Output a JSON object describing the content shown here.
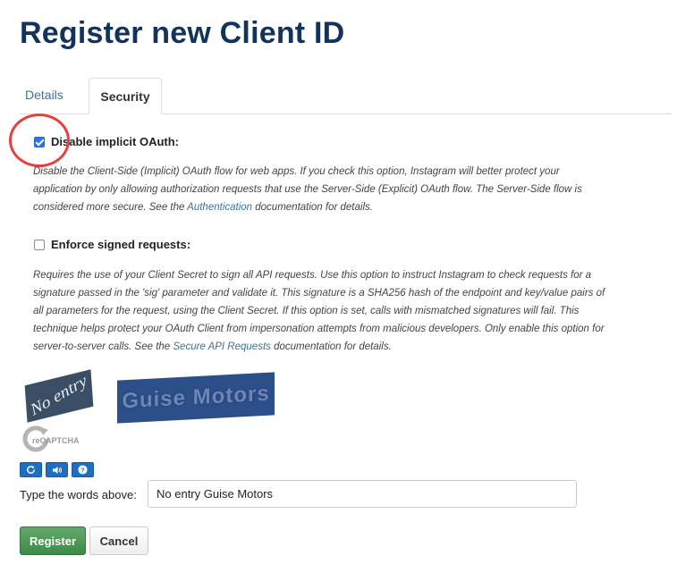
{
  "page": {
    "title": "Register new Client ID"
  },
  "tabs": [
    {
      "label": "Details",
      "active": false
    },
    {
      "label": "Security",
      "active": true
    }
  ],
  "options": {
    "implicit_oauth": {
      "label": "Disable implicit OAuth:",
      "checked": true,
      "help_parts": [
        "Disable the Client-Side (Implicit) OAuth flow for web apps. If you check this option, Instagram will better protect your",
        "application by only allowing authorization requests that use the Server-Side (Explicit) OAuth flow. The Server-Side flow is",
        "considered more secure. See the ",
        "Authentication",
        " documentation for details."
      ]
    },
    "signed_requests": {
      "label": "Enforce signed requests:",
      "checked": false,
      "help_parts": [
        "Requires the use of your Client Secret to sign all API requests. Use this option to instruct Instagram to check requests for a",
        "signature passed in the 'sig' parameter and validate it. This signature is a SHA256 hash of the endpoint and key/value pairs of",
        "all parameters for the request, using the Client Secret. If this option is set, calls with mismatched signatures will fail. This",
        "technique helps protect your OAuth Client from impersonation attempts from malicious developers. Only enable this option for",
        "server-to-server calls. See the ",
        "Secure API Requests",
        " documentation for details."
      ]
    }
  },
  "captcha": {
    "word1": "No entry",
    "word2": "Guise Motors",
    "logo_text": "reCAPTCHA",
    "buttons": [
      "refresh-icon",
      "audio-icon",
      "help-icon"
    ],
    "prompt_label": "Type the words above:",
    "input_value": "No entry Guise Motors"
  },
  "actions": {
    "register_label": "Register",
    "cancel_label": "Cancel"
  },
  "colors": {
    "title": "#12335c",
    "link": "#3f729b",
    "annotation_circle": "#e8403e",
    "register_button": "#4a954f"
  }
}
